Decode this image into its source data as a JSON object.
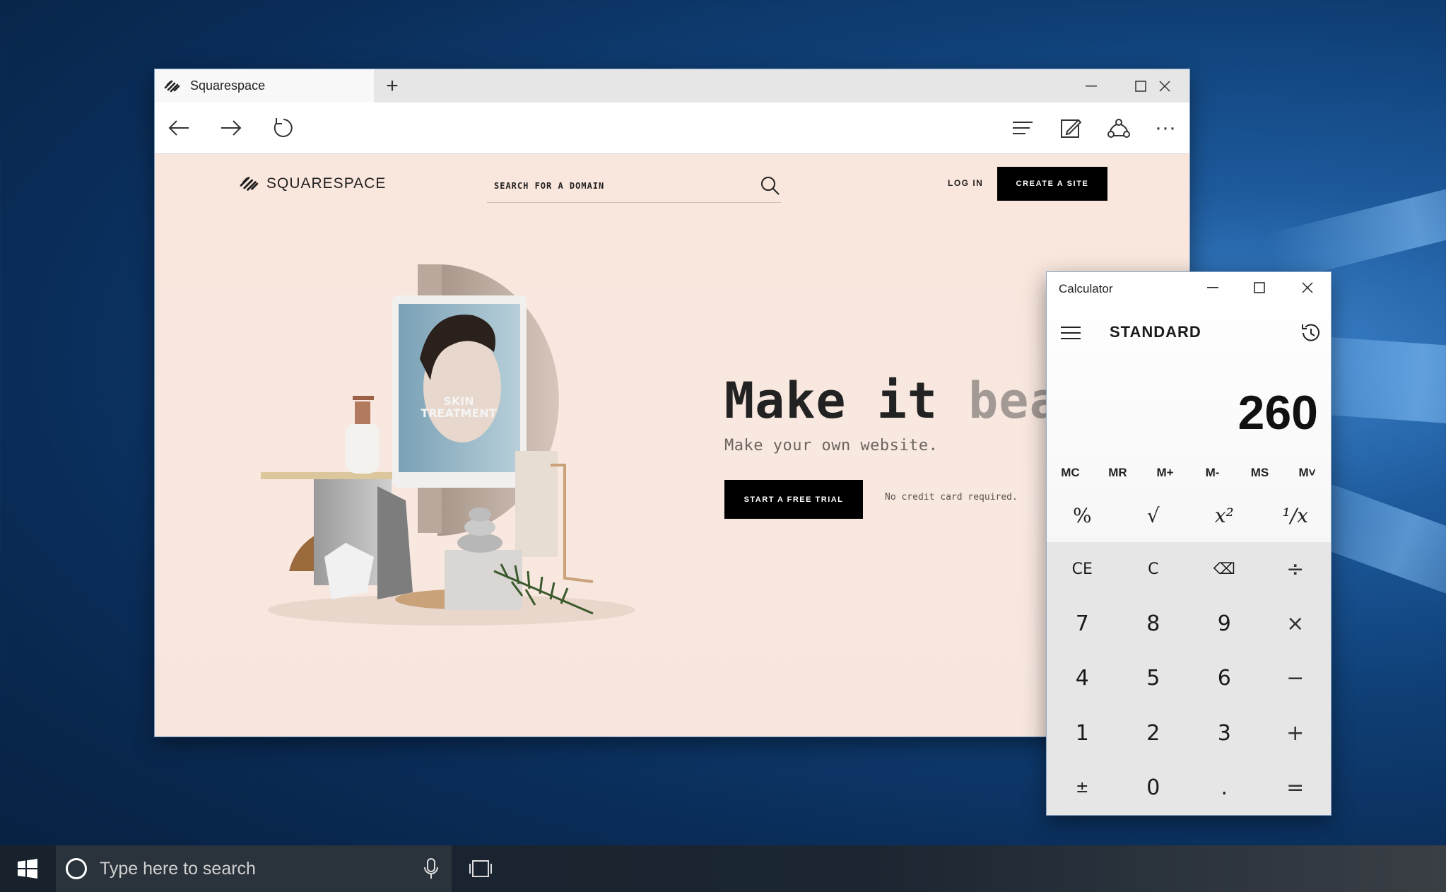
{
  "browser": {
    "tab_title": "Squarespace",
    "new_tab": "+",
    "controls": {
      "minimize": "—",
      "maximize": "☐",
      "close": "✕"
    },
    "toolbar": {
      "back": "←",
      "forward": "→",
      "refresh": "↻",
      "more": "···"
    }
  },
  "site": {
    "logo_text": "SQUARESPACE",
    "search_placeholder": "SEARCH FOR A DOMAIN",
    "login_label": "LOG IN",
    "create_label": "CREATE A SITE",
    "hero_title_dark": "Make it ",
    "hero_title_light": "beautif",
    "hero_subtitle": "Make your own website.",
    "trial_label": "START A FREE TRIAL",
    "no_cc_text": "No credit card required.",
    "tablet_text_1": "SKIN",
    "tablet_text_2": "TREATMENT"
  },
  "calculator": {
    "title": "Calculator",
    "mode": "STANDARD",
    "display": "260",
    "memory": [
      "MC",
      "MR",
      "M+",
      "M-",
      "MS",
      "M˅"
    ],
    "functions": [
      "%",
      "√",
      "x²",
      "¹/x"
    ],
    "keys": [
      "CE",
      "C",
      "⌫",
      "÷",
      "7",
      "8",
      "9",
      "×",
      "4",
      "5",
      "6",
      "−",
      "1",
      "2",
      "3",
      "+",
      "±",
      "0",
      ".",
      "="
    ]
  },
  "taskbar": {
    "search_placeholder": "Type here to search"
  }
}
